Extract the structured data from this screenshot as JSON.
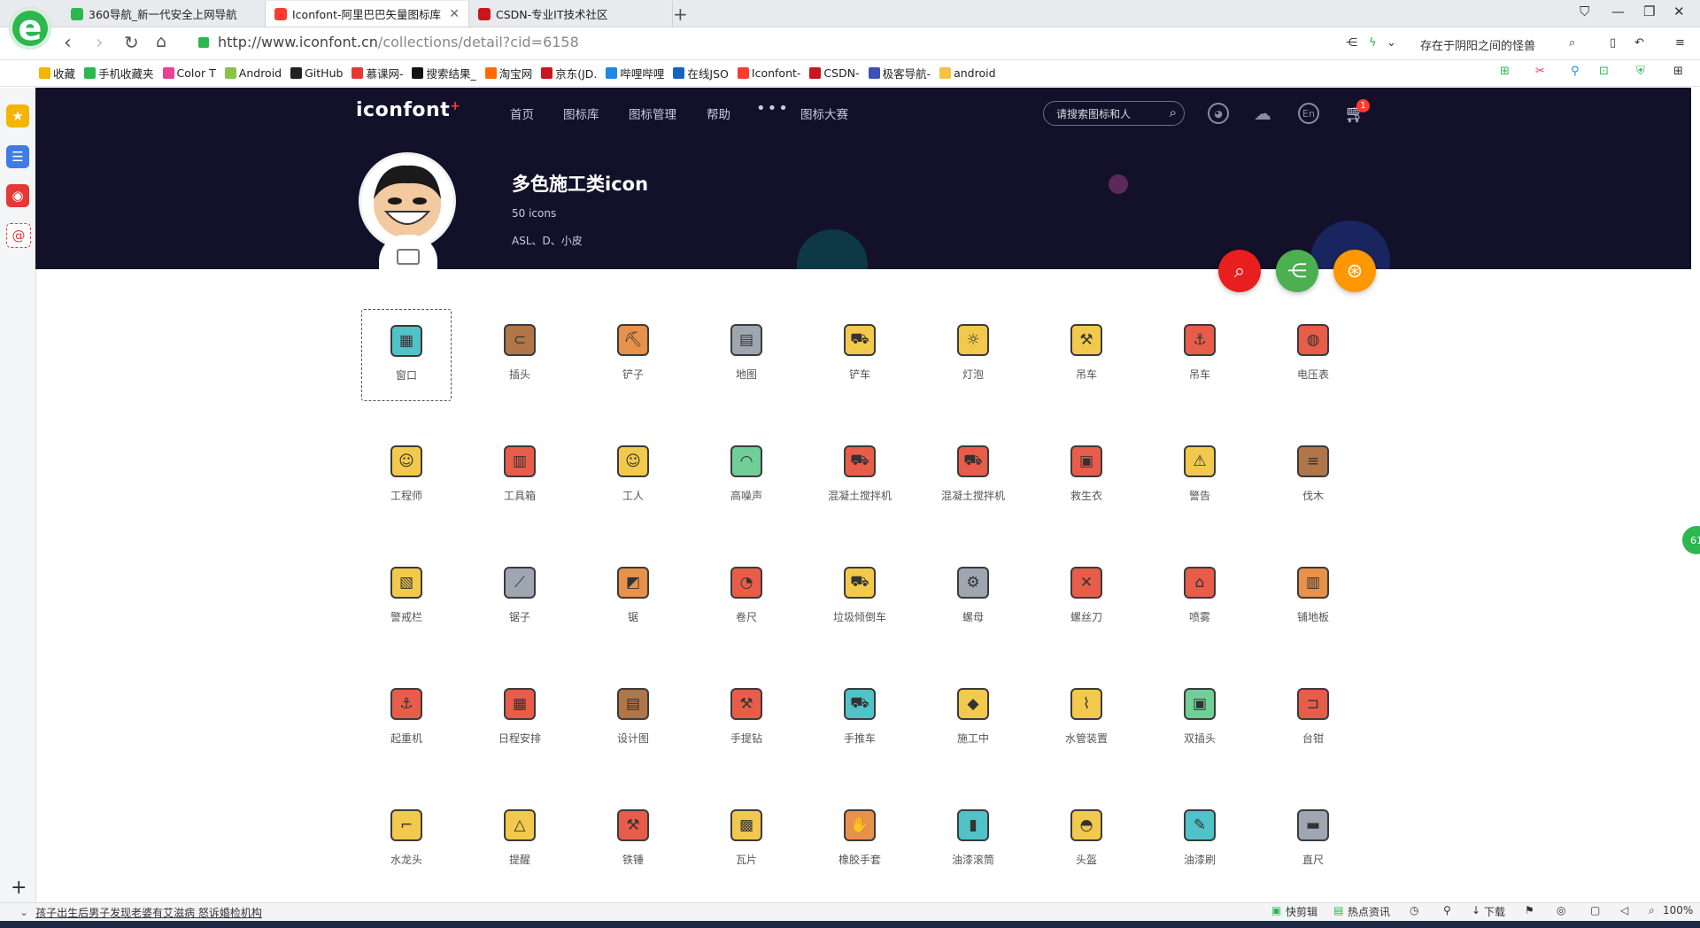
{
  "browser": {
    "tabs": [
      {
        "label": "360导航_新一代安全上网导航",
        "color": "#2cb74f"
      },
      {
        "label": "Iconfont-阿里巴巴矢量图标库",
        "color": "#ff3b30"
      },
      {
        "label": "CSDN-专业IT技术社区",
        "color": "#c8161d"
      }
    ],
    "url_main": "http://www.iconfont.cn",
    "url_path": "/collections/detail?cid=6158",
    "account": "存在于阴阳之间的怪兽",
    "bookmarks": [
      {
        "label": "收藏",
        "color": "#f5b400"
      },
      {
        "label": "手机收藏夹",
        "color": "#2cb74f"
      },
      {
        "label": "Color T",
        "color": "#e84393"
      },
      {
        "label": "Android",
        "color": "#8bc34a"
      },
      {
        "label": "GitHub",
        "color": "#222222"
      },
      {
        "label": "慕课网-",
        "color": "#e53935"
      },
      {
        "label": "搜索结果_",
        "color": "#111111"
      },
      {
        "label": "淘宝网",
        "color": "#ff6a00"
      },
      {
        "label": "京东(JD.",
        "color": "#c8161d"
      },
      {
        "label": "哔哩哔哩",
        "color": "#1e88e5"
      },
      {
        "label": "在线JSO",
        "color": "#1565c0"
      },
      {
        "label": "Iconfont-",
        "color": "#ff3b30"
      },
      {
        "label": "CSDN-",
        "color": "#c8161d"
      },
      {
        "label": "极客导航-",
        "color": "#3f51b5"
      },
      {
        "label": "android",
        "color": "#f5c242"
      }
    ],
    "status_left": "孩子出生后男子发现老婆有艾滋病 怒诉婚检机构",
    "status_right": [
      "快剪辑",
      "热点资讯",
      "下载",
      "100%"
    ],
    "side_bubble": "61"
  },
  "site": {
    "logo": "iconfont",
    "nav": [
      "首页",
      "图标库",
      "图标管理",
      "帮助",
      "图标大赛"
    ],
    "more": "•••",
    "search_placeholder": "请搜索图标和人",
    "header_icons": [
      "github-icon",
      "upload-icon",
      "language-icon"
    ],
    "lang_label": "En",
    "cart_count": "1"
  },
  "collection": {
    "title": "多色施工类icon",
    "count": "50 icons",
    "authors": "ASL、D、小皮"
  },
  "fabs": [
    {
      "name": "search",
      "color": "#e91e1e",
      "glyph": "⌕"
    },
    {
      "name": "share",
      "color": "#4caf50",
      "glyph": "⋲"
    },
    {
      "name": "download",
      "color": "#ff9800",
      "glyph": "⊛"
    }
  ],
  "icons": [
    {
      "label": "窗口",
      "color": "#4fc3c8"
    },
    {
      "label": "插头",
      "color": "#b0764a"
    },
    {
      "label": "铲子",
      "color": "#e8914a"
    },
    {
      "label": "地图",
      "color": "#9ea7b1"
    },
    {
      "label": "铲车",
      "color": "#f2c94c"
    },
    {
      "label": "灯泡",
      "color": "#f2c94c"
    },
    {
      "label": "吊车",
      "color": "#f2c94c"
    },
    {
      "label": "吊车",
      "color": "#e85d4a"
    },
    {
      "label": "电压表",
      "color": "#e85d4a"
    },
    {
      "label": "工程师",
      "color": "#f2c94c"
    },
    {
      "label": "工具箱",
      "color": "#e85d4a"
    },
    {
      "label": "工人",
      "color": "#f2c94c"
    },
    {
      "label": "高噪声",
      "color": "#6fcf97"
    },
    {
      "label": "混凝土搅拌机",
      "color": "#e85d4a"
    },
    {
      "label": "混凝土搅拌机",
      "color": "#e85d4a"
    },
    {
      "label": "救生衣",
      "color": "#e85d4a"
    },
    {
      "label": "警告",
      "color": "#f2c94c"
    },
    {
      "label": "伐木",
      "color": "#b0764a"
    },
    {
      "label": "警戒栏",
      "color": "#f2c94c"
    },
    {
      "label": "锯子",
      "color": "#9ea7b1"
    },
    {
      "label": "锯",
      "color": "#e8914a"
    },
    {
      "label": "卷尺",
      "color": "#e85d4a"
    },
    {
      "label": "垃圾倾倒车",
      "color": "#f2c94c"
    },
    {
      "label": "螺母",
      "color": "#9ea7b1"
    },
    {
      "label": "螺丝刀",
      "color": "#e85d4a"
    },
    {
      "label": "喷雾",
      "color": "#e85d4a"
    },
    {
      "label": "铺地板",
      "color": "#e8914a"
    },
    {
      "label": "起重机",
      "color": "#e85d4a"
    },
    {
      "label": "日程安排",
      "color": "#e85d4a"
    },
    {
      "label": "设计图",
      "color": "#b0764a"
    },
    {
      "label": "手提钻",
      "color": "#e85d4a"
    },
    {
      "label": "手推车",
      "color": "#4fc3c8"
    },
    {
      "label": "施工中",
      "color": "#f2c94c"
    },
    {
      "label": "水管装置",
      "color": "#f2c94c"
    },
    {
      "label": "双插头",
      "color": "#6fcf97"
    },
    {
      "label": "台钳",
      "color": "#e85d4a"
    },
    {
      "label": "水龙头",
      "color": "#f2c94c"
    },
    {
      "label": "提醒",
      "color": "#f2c94c"
    },
    {
      "label": "铁锤",
      "color": "#e85d4a"
    },
    {
      "label": "瓦片",
      "color": "#f2c94c"
    },
    {
      "label": "橡胶手套",
      "color": "#e8914a"
    },
    {
      "label": "油漆滚筒",
      "color": "#4fc3c8"
    },
    {
      "label": "头盔",
      "color": "#f2c94c"
    },
    {
      "label": "油漆刷",
      "color": "#4fc3c8"
    },
    {
      "label": "直尺",
      "color": "#9ea7b1"
    }
  ]
}
